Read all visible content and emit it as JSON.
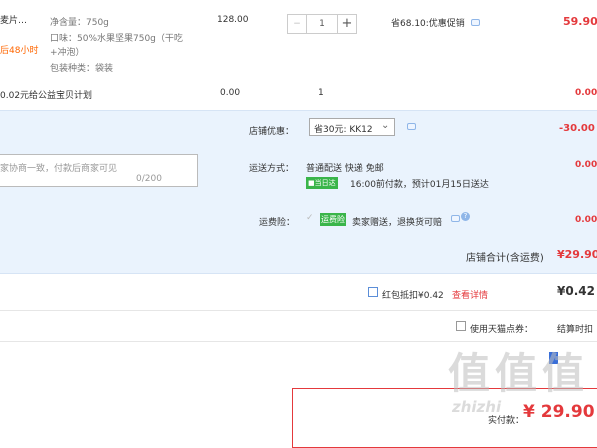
{
  "item": {
    "title": "麦片…",
    "delivery_note": "后48小时",
    "spec_weight": "净含量：750g",
    "spec_flavor_1": "口味：50%水果坚果750g（干吃",
    "spec_flavor_2": "+冲泡）",
    "spec_pack": "包装种类：袋装",
    "unit_price": "128.00",
    "quantity": "1",
    "minus": "−",
    "plus": "+",
    "promo": "省68.10:优惠促销",
    "subtotal": "59.90"
  },
  "charity": {
    "label": "0.02元给公益宝贝计划",
    "price": "0.00",
    "qty": "1",
    "amount": "0.00"
  },
  "shop": {
    "discount_label": "店铺优惠：",
    "discount_select": "省30元: KK12",
    "discount_amount": "-30.00",
    "message_placeholder": "家协商一致，付款后商家可见",
    "message_count": "0/200",
    "shipping_label": "运送方式：",
    "shipping_method": "普通配送 快递 免邮",
    "shipping_badge": "■当日达",
    "shipping_eta": "16:00前付款，预计01月15日送达",
    "shipping_amount": "0.00",
    "insurance_label": "运费险：",
    "insurance_badge": "运费险",
    "insurance_text": "卖家赠送，退换货可赔",
    "insurance_amount": "0.00",
    "total_label": "店铺合计(含运费)",
    "total_amount": "¥29.90"
  },
  "redpacket": {
    "label": "红包抵扣¥0.42",
    "detail_link": "查看详情",
    "amount": "¥0.42"
  },
  "points": {
    "label": "使用天猫点券：",
    "tail": "结算时扣"
  },
  "pay": {
    "label": "实付款：",
    "amount": "¥ 29.90"
  },
  "watermark": {
    "logo": "值",
    "domain": "zhizhi"
  },
  "colors": {
    "price_red": "#e4393c",
    "band_blue": "#eaf3fd",
    "delivery_orange": "#ff6600",
    "badge_green": "#3ab54a"
  }
}
